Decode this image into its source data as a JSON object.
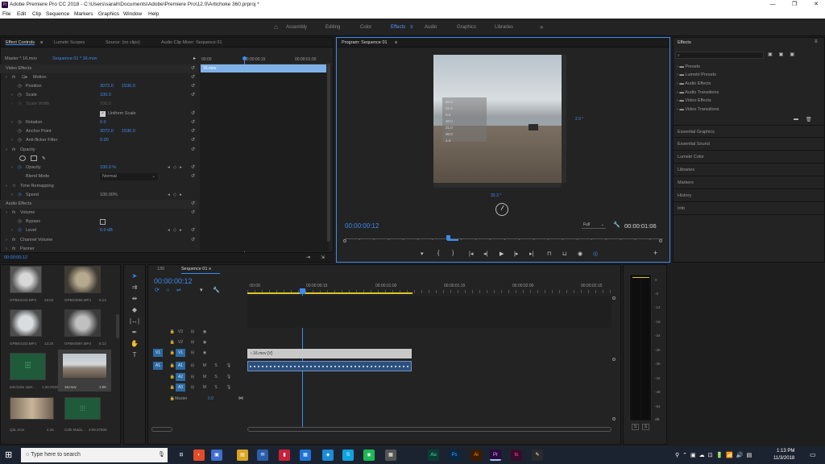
{
  "window": {
    "title": "Adobe Premiere Pro CC 2018 - C:\\Users\\sarah\\Documents\\Adobe\\Premiere Pro\\12.0\\Artichoke 360.prproj *",
    "app_icon": "Pr",
    "minimize": "—",
    "maximize": "❐",
    "close": "✕"
  },
  "menu": [
    "File",
    "Edit",
    "Clip",
    "Sequence",
    "Markers",
    "Graphics",
    "Window",
    "Help"
  ],
  "workspaces": {
    "home": "⌂",
    "tabs": [
      "Assembly",
      "Editing",
      "Color",
      "Effects",
      "Audio",
      "Graphics",
      "Libraries"
    ],
    "active": "Effects",
    "active_menu": "≡",
    "more": "»"
  },
  "effect_controls": {
    "tabs": [
      "Effect Controls",
      "Lumetri Scopes",
      "Source: (no clips)",
      "Audio Clip Mixer: Sequence 01"
    ],
    "tab_menu": "≡",
    "master": "Master * 16.mov",
    "clip": "Sequence 01 * 16.mov",
    "collapse": "▸",
    "ruler": [
      "00:00",
      "00:00:00:15",
      "00:00:01:00"
    ],
    "clip_bar": "16.mov",
    "video_effects": "Video Effects",
    "motion": "Motion",
    "position": {
      "label": "Position",
      "x": "3072.0",
      "y": "1536.0"
    },
    "scale": {
      "label": "Scale",
      "value": "100.0"
    },
    "scale_width": {
      "label": "Scale Width",
      "value": "100.0"
    },
    "uniform_scale": "Uniform Scale",
    "rotation": {
      "label": "Rotation",
      "value": "0.0"
    },
    "anchor_point": {
      "label": "Anchor Point",
      "x": "3072.0",
      "y": "1536.0"
    },
    "anti_flicker": {
      "label": "Anti-flicker Filter",
      "value": "0.00"
    },
    "opacity_section": "Opacity",
    "opacity": {
      "label": "Opacity",
      "value": "100.0 %"
    },
    "blend_mode": {
      "label": "Blend Mode",
      "value": "Normal"
    },
    "time_remapping": "Time Remapping",
    "speed": {
      "label": "Speed",
      "value": "100.00%"
    },
    "audio_effects": "Audio Effects",
    "volume": "Volume",
    "bypass": "Bypass",
    "level": {
      "label": "Level",
      "value": "0.0 dB"
    },
    "channel_volume": "Channel Volume",
    "panner": "Panner",
    "timecode": "00:00:00:12",
    "reset": "↺",
    "fx": "fx",
    "kf_prev": "◂",
    "kf_add": "◇",
    "kf_next": "▸"
  },
  "program": {
    "title": "Program: Sequence 01",
    "menu": "≡",
    "overlay": [
      "90.0",
      "31.0",
      "0.0",
      "30.0",
      "31.0",
      "30.0",
      "1.4"
    ],
    "angle_right": "2.9 °",
    "angle_bottom": "33.3 °",
    "timecode": "00:00:00:12",
    "zoom": "Full",
    "duration": "00:00:01:06",
    "controls": [
      "▾",
      "{",
      "}",
      "|◂",
      "◂|",
      "▶",
      "|▸",
      "▸|",
      "⊓",
      "⊔",
      "◉",
      "◎"
    ],
    "add": "+"
  },
  "effects": {
    "title": "Effects",
    "menu": "≡",
    "search_placeholder": "",
    "tree": [
      "Presets",
      "Lumetri Presets",
      "Audio Effects",
      "Audio Transitions",
      "Video Effects",
      "Video Transitions"
    ],
    "categories": [
      "Essential Graphics",
      "Essential Sound",
      "Lumetri Color",
      "Libraries",
      "Markers",
      "History",
      "Info"
    ]
  },
  "project": {
    "items": [
      {
        "name": "GPBK0103.MP4",
        "dur": "26:04"
      },
      {
        "name": "GPBK0096.MP4",
        "dur": "5:14"
      },
      {
        "name": "GPBK0103.MP4",
        "dur": "13:20"
      },
      {
        "name": "GPBK0097.MP4",
        "dur": "6:12"
      },
      {
        "name": "artichoke start...",
        "dur": "1:26:2033"
      },
      {
        "name": "16.mov",
        "dur": "1:06"
      },
      {
        "name": "Q2L.mov",
        "dur": "4:26"
      },
      {
        "name": "Cafe Mada...",
        "dur": "3:09:37509"
      }
    ]
  },
  "timeline": {
    "tabs": [
      "130",
      "Sequence 01"
    ],
    "menu": "≡",
    "timecode": "00:00:00:12",
    "ruler": [
      ":00:00",
      "00:00:00:15",
      "00:00:01:00",
      "00:00:01:15",
      "00:00:02:00",
      "00:00:02:15"
    ],
    "tracks": [
      {
        "src": "",
        "id": "V3",
        "lock": "🔒",
        "toggle": "⊟",
        "eye": "◉"
      },
      {
        "src": "",
        "id": "V2",
        "lock": "🔒",
        "toggle": "⊟",
        "eye": "◉"
      },
      {
        "src": "V1",
        "id": "V1",
        "lock": "🔒",
        "toggle": "⊟",
        "eye": "◉"
      }
    ],
    "audio_tracks": [
      {
        "src": "A1",
        "id": "A1",
        "m": "M",
        "s": "S",
        "mic": "🎙"
      },
      {
        "src": "",
        "id": "A2",
        "m": "M",
        "s": "S",
        "mic": "🎙"
      },
      {
        "src": "",
        "id": "A3",
        "m": "M",
        "s": "S",
        "mic": "🎙"
      }
    ],
    "master": "Master",
    "master_value": "0.0",
    "video_clip": "16.mov [V]"
  },
  "meter": {
    "scale": [
      "0",
      "-6",
      "-12",
      "-18",
      "-24",
      "-30",
      "-36",
      "-42",
      "-48",
      "-54",
      "dB"
    ],
    "solo": [
      "S",
      "S"
    ]
  },
  "taskbar": {
    "search_placeholder": "Type here to search",
    "apps": [
      "⊟",
      "◐",
      "▣",
      "▤",
      "✉",
      "▮",
      "▦",
      "◈",
      "S",
      "◉",
      "▦",
      "Au",
      "Ps",
      "Ai",
      "Pr",
      "Ic",
      "✎"
    ],
    "time": "1:13 PM",
    "date": "11/3/2018"
  },
  "colors": {
    "accent": "#3b8cf0",
    "titlebar": "#ffffff",
    "panel": "#232323",
    "taskbar": "#1c2330"
  }
}
